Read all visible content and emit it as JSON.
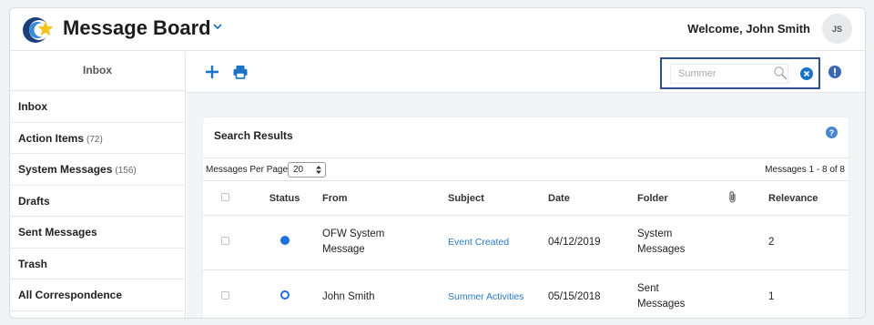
{
  "app": {
    "title": "Message Board"
  },
  "header": {
    "welcome": "Welcome, John Smith",
    "avatar_initials": "JS"
  },
  "sidebar": {
    "header": "Inbox",
    "items": [
      {
        "label": "Inbox",
        "count": ""
      },
      {
        "label": "Action Items",
        "count": "(72)"
      },
      {
        "label": "System Messages",
        "count": "(156)"
      },
      {
        "label": "Drafts",
        "count": ""
      },
      {
        "label": "Sent Messages",
        "count": ""
      },
      {
        "label": "Trash",
        "count": ""
      },
      {
        "label": "All Correspondence",
        "count": ""
      }
    ]
  },
  "toolbar": {
    "add_icon": "plus-icon",
    "print_icon": "printer-icon"
  },
  "search": {
    "placeholder": "Summer",
    "value": ""
  },
  "results": {
    "title": "Search Results",
    "per_page_label": "Messages Per Page",
    "per_page_value": "20",
    "range_label": "Messages 1 - 8 of 8",
    "columns": [
      "Status",
      "From",
      "Subject",
      "Date",
      "Folder",
      "Relevance"
    ],
    "rows": [
      {
        "status": "unread",
        "from": "OFW System Message",
        "subject": "Event Created",
        "date": "04/12/2019",
        "folder": "System Messages",
        "relevance": "2"
      },
      {
        "status": "read",
        "from": "John Smith",
        "subject": "Summer Activities",
        "date": "05/15/2018",
        "folder": "Sent Messages",
        "relevance": "1"
      }
    ]
  },
  "colors": {
    "accent": "#2c4f91",
    "link": "#2a78c2",
    "status": "#1f6fe0",
    "icon_blue": "#1a73c7"
  }
}
